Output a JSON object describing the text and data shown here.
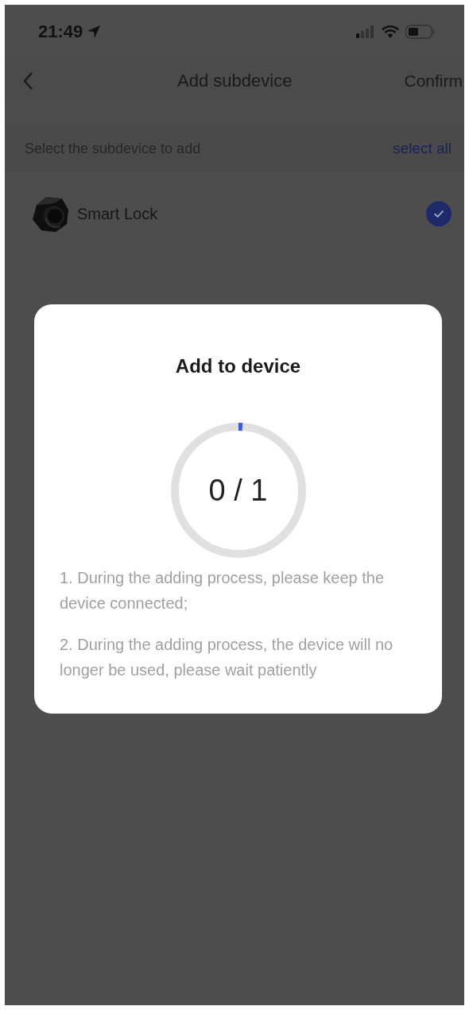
{
  "status_bar": {
    "time": "21:49"
  },
  "nav": {
    "title": "Add subdevice",
    "action": "Confirm"
  },
  "section": {
    "hint": "Select the subdevice to add",
    "select_all": "select all"
  },
  "devices": [
    {
      "name": "Smart Lock",
      "checked": true
    }
  ],
  "dialog": {
    "title": "Add to device",
    "progress": {
      "level": 0.01,
      "count": "0 / 1"
    },
    "notes": [
      "1. During the adding process, please keep the device connected;",
      "2. During the adding process, the device will no longer be used, please wait patiently"
    ]
  }
}
